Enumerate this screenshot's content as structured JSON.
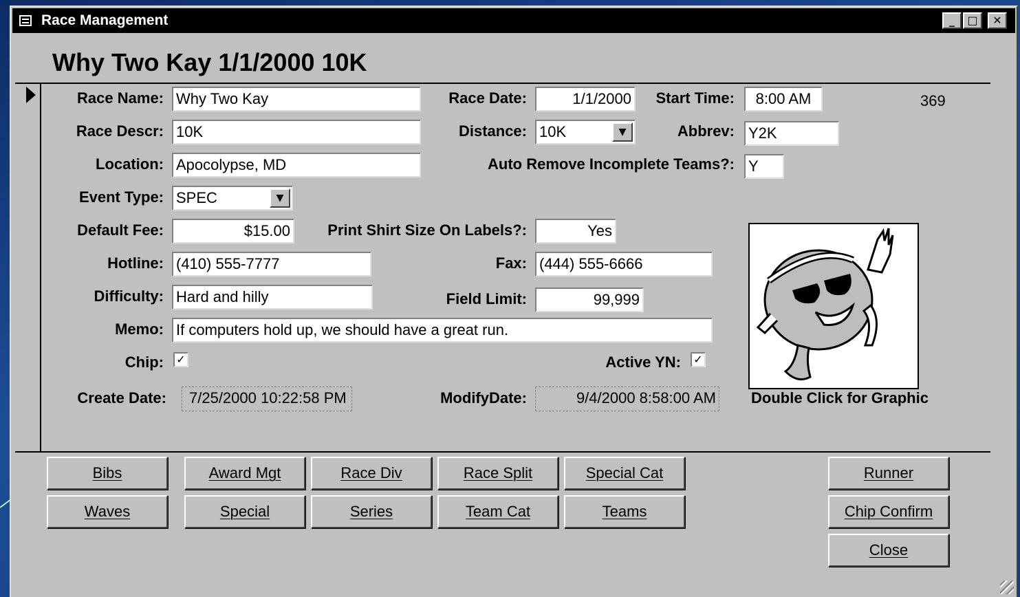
{
  "window": {
    "title": "Race Management",
    "controls": [
      "_",
      "□",
      "✕"
    ]
  },
  "heading": "Why Two Kay 1/1/2000 10K",
  "record_id": "369",
  "fields": {
    "race_name": {
      "label": "Race Name:",
      "value": "Why Two Kay"
    },
    "race_date": {
      "label": "Race Date:",
      "value": "1/1/2000"
    },
    "start_time": {
      "label": "Start Time:",
      "value": "8:00 AM"
    },
    "race_descr": {
      "label": "Race Descr:",
      "value": "10K"
    },
    "distance": {
      "label": "Distance:",
      "value": "10K"
    },
    "abbrev": {
      "label": "Abbrev:",
      "value": "Y2K"
    },
    "location": {
      "label": "Location:",
      "value": "Apocolypse, MD"
    },
    "auto_remove": {
      "label": "Auto Remove Incomplete Teams?:",
      "value": "Y"
    },
    "event_type": {
      "label": "Event Type:",
      "value": "SPEC"
    },
    "default_fee": {
      "label": "Default Fee:",
      "value": "$15.00"
    },
    "print_shirt": {
      "label": "Print Shirt Size On Labels?:",
      "value": "Yes"
    },
    "hotline": {
      "label": "Hotline:",
      "value": "(410) 555-7777"
    },
    "fax": {
      "label": "Fax:",
      "value": "(444) 555-6666"
    },
    "difficulty": {
      "label": "Difficulty:",
      "value": "Hard and hilly"
    },
    "field_limit": {
      "label": "Field Limit:",
      "value": "99,999"
    },
    "memo": {
      "label": "Memo:",
      "value": "If computers hold up, we should have a great run."
    },
    "chip": {
      "label": "Chip:",
      "checked": true
    },
    "active_yn": {
      "label": "Active YN:",
      "checked": true
    },
    "create_date": {
      "label": "Create Date:",
      "value": "7/25/2000 10:22:58 PM"
    },
    "modify_date": {
      "label": "ModifyDate:",
      "value": "9/4/2000 8:58:00 AM"
    }
  },
  "graphic_caption": "Double Click for Graphic",
  "check_glyph": "✓",
  "dropdown_glyph": "▼",
  "buttons": {
    "bibs": "Bibs",
    "award_mgt": "Award Mgt",
    "race_div": "Race Div",
    "race_split": "Race Split",
    "special_cat": "Special Cat",
    "runner": "Runner",
    "waves": "Waves",
    "special": "Special",
    "series": "Series",
    "team_cat": "Team Cat",
    "teams": "Teams",
    "chip_confirm": "Chip Confirm",
    "close": "Close"
  },
  "colors": {
    "form_bg": "#c0c0c0",
    "titlebar_bg": "#000000",
    "desktop_bg": "#1e4d95",
    "arrow": "#b8f0c0"
  }
}
